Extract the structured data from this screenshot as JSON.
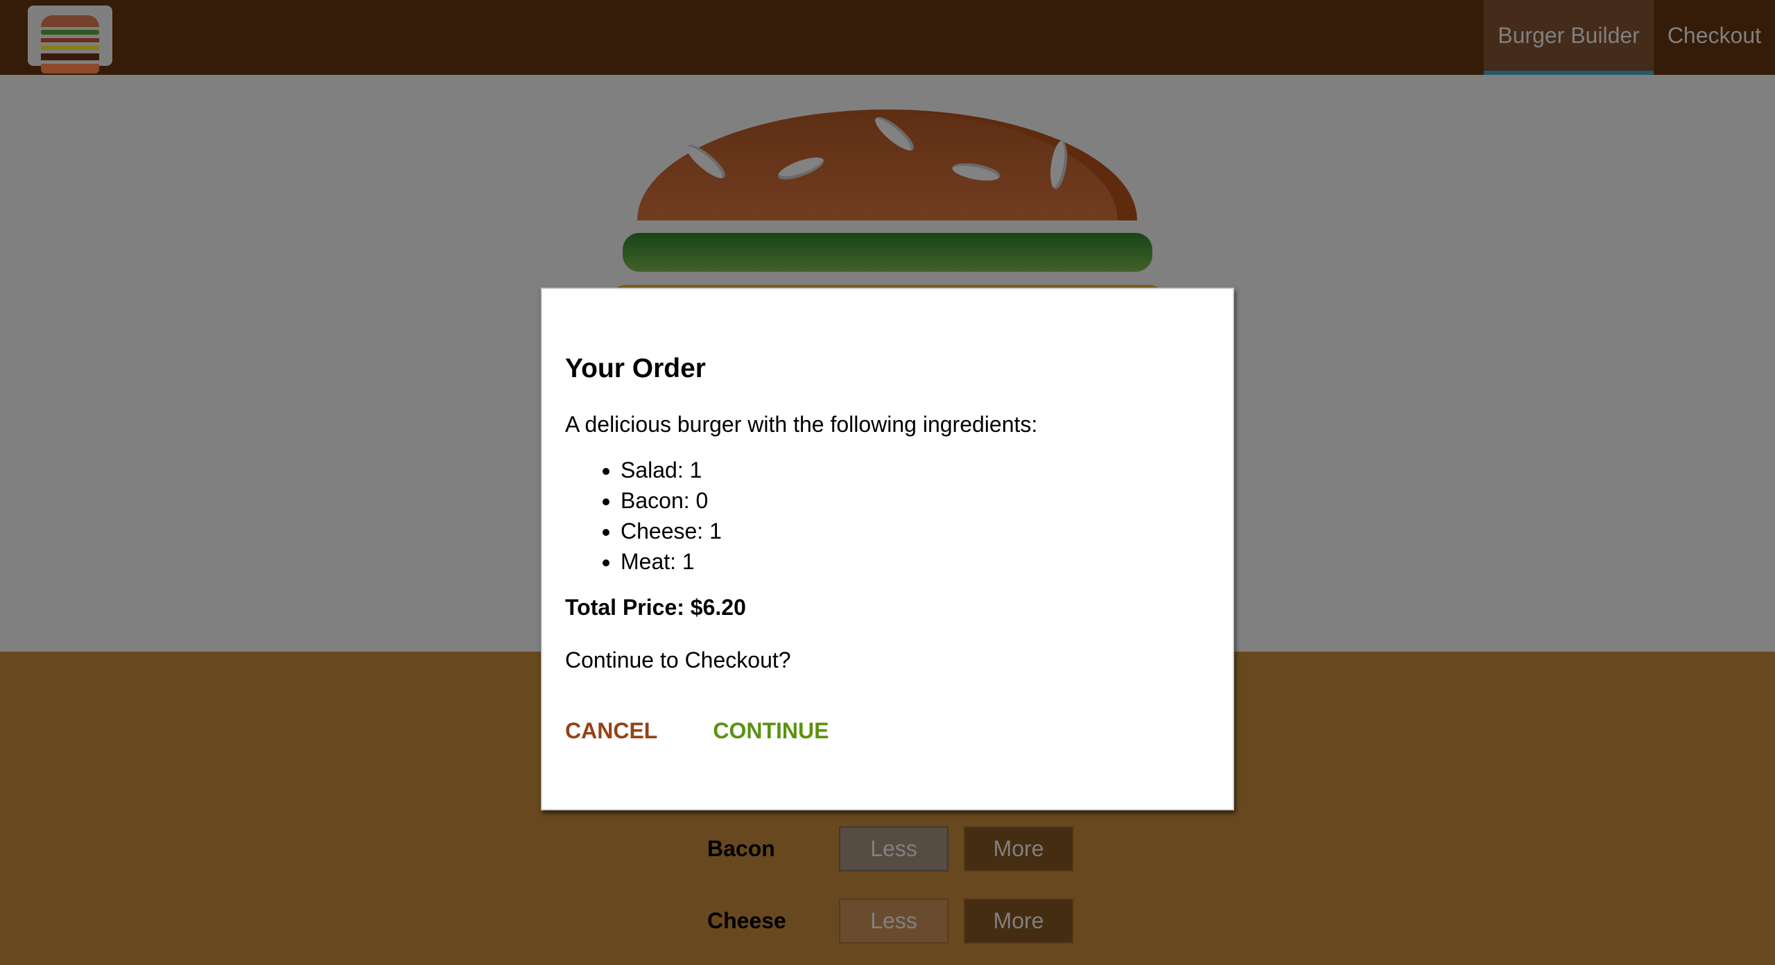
{
  "header": {
    "logo_icon": "burger-logo-icon",
    "nav": [
      {
        "label": "Burger Builder",
        "active": true
      },
      {
        "label": "Checkout",
        "active": false
      }
    ]
  },
  "controls": [
    {
      "label": "Bacon",
      "less": "Less",
      "more": "More",
      "less_disabled": true
    },
    {
      "label": "Cheese",
      "less": "Less",
      "more": "More",
      "less_disabled": false
    }
  ],
  "modal": {
    "title": "Your Order",
    "intro": "A delicious burger with the following ingredients:",
    "ingredients": [
      "Salad: 1",
      "Bacon: 0",
      "Cheese: 1",
      "Meat: 1"
    ],
    "total": "Total Price: $6.20",
    "question": "Continue to Checkout?",
    "cancel": "CANCEL",
    "continue": "CONTINUE"
  },
  "colors": {
    "header": "#703b09",
    "cancel": "#944317",
    "continue": "#5c9210",
    "controls_bg": "#cf8f2e"
  }
}
